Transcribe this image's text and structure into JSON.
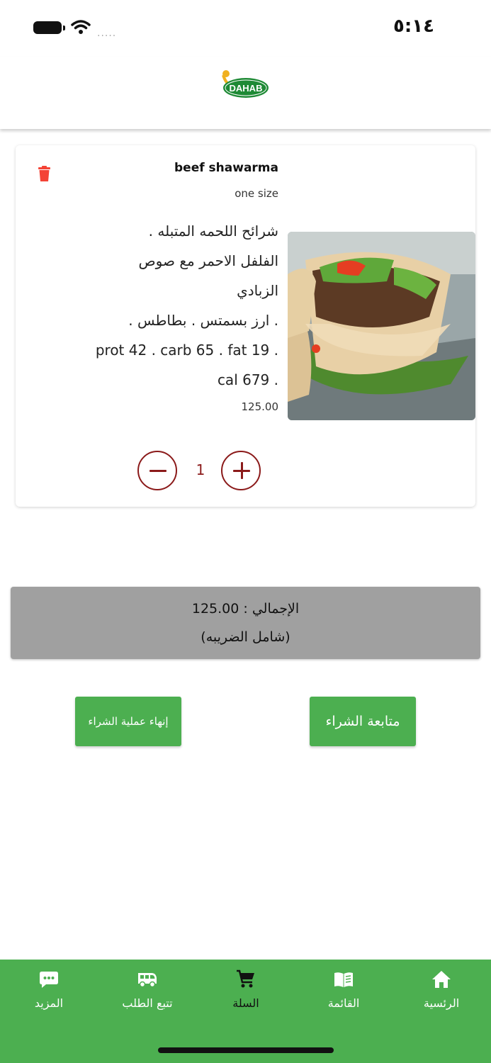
{
  "status_bar": {
    "time": "٥:١٤",
    "signal": "....."
  },
  "header": {
    "logo_text": "DAHAB",
    "brand_color": "#1e8a35"
  },
  "cart_item": {
    "name": "beef shawarma",
    "size": "one size",
    "description_lines": [
      "شرائح اللحمه المتبله .",
      "الفلفل الاحمر مع صوص",
      "الزبادي",
      ". ارز بسمتس . بطاطس .",
      ". prot 42 . carb 65 . fat 19",
      ". cal 679"
    ],
    "price": "125.00",
    "quantity": "1",
    "delete_icon": "trash-icon",
    "accent_color": "#8b1a1a"
  },
  "summary": {
    "total": "الإجمالي : 125.00",
    "tax_note": "(شامل الضريبه)"
  },
  "actions": {
    "finish_label": "إنهاء عملية الشراء",
    "continue_label": "متابعة الشراء"
  },
  "nav": {
    "items": [
      {
        "label": "المزيد",
        "icon": "chat-bubble-icon"
      },
      {
        "label": "تتبع الطلب",
        "icon": "delivery-van-icon"
      },
      {
        "label": "السلة",
        "icon": "cart-icon"
      },
      {
        "label": "القائمة",
        "icon": "menu-book-icon"
      },
      {
        "label": "الرئسية",
        "icon": "home-icon"
      }
    ],
    "color": "#4caf50"
  }
}
